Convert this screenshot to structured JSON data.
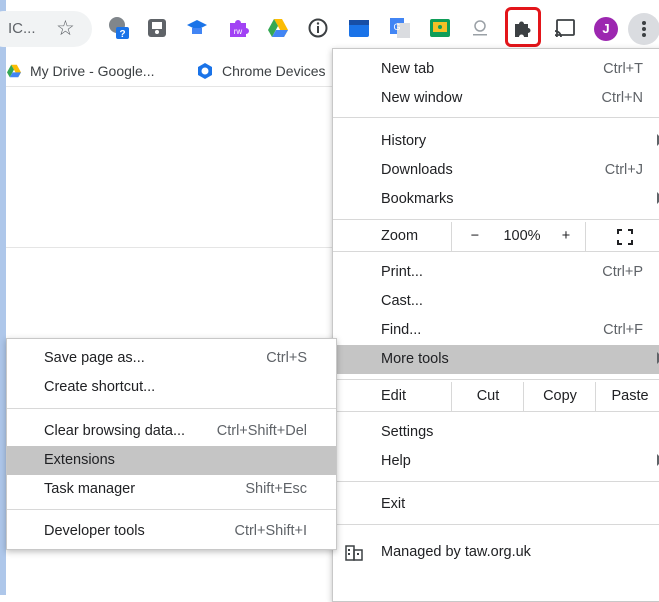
{
  "toolbar": {
    "omnibox_text": "IC...",
    "icons": [
      "star-icon",
      "extension-speech-icon",
      "extension-save-icon",
      "extension-graduation-icon",
      "extension-rw-icon",
      "google-drive-icon",
      "info-icon",
      "extension-calendar-icon",
      "google-translate-icon",
      "google-classroom-icon",
      "extension-search-icon",
      "puzzle-icon",
      "cast-icon",
      "avatar",
      "more-vert-icon"
    ],
    "avatar_letter": "J",
    "extension_badge": "?",
    "rw_badge": "rw",
    "colors": {
      "puzzle_highlight": "#e3151a",
      "avatar": "#9c27b0"
    }
  },
  "bookmarks": [
    {
      "label": "My Drive - Google...",
      "icon": "google-drive-icon"
    },
    {
      "label": "Chrome Devices",
      "icon": "chrome-devices-icon"
    }
  ],
  "menu": {
    "new_tab": {
      "label": "New tab",
      "shortcut": "Ctrl+T"
    },
    "new_window": {
      "label": "New window",
      "shortcut": "Ctrl+N"
    },
    "history": {
      "label": "History"
    },
    "downloads": {
      "label": "Downloads",
      "shortcut": "Ctrl+J"
    },
    "bookmarks": {
      "label": "Bookmarks"
    },
    "zoom": {
      "label": "Zoom",
      "minus": "−",
      "value": "100%",
      "plus": "+"
    },
    "print": {
      "label": "Print...",
      "shortcut": "Ctrl+P"
    },
    "cast": {
      "label": "Cast..."
    },
    "find": {
      "label": "Find...",
      "shortcut": "Ctrl+F"
    },
    "more_tools": {
      "label": "More tools"
    },
    "edit": {
      "label": "Edit",
      "cut": "Cut",
      "copy": "Copy",
      "paste": "Paste"
    },
    "settings": {
      "label": "Settings"
    },
    "help": {
      "label": "Help"
    },
    "exit": {
      "label": "Exit"
    },
    "managed": {
      "label": "Managed by taw.org.uk"
    }
  },
  "submenu": {
    "save_page": {
      "label": "Save page as...",
      "shortcut": "Ctrl+S"
    },
    "create_shortcut": {
      "label": "Create shortcut..."
    },
    "clear_data": {
      "label": "Clear browsing data...",
      "shortcut": "Ctrl+Shift+Del"
    },
    "extensions": {
      "label": "Extensions"
    },
    "task_manager": {
      "label": "Task manager",
      "shortcut": "Shift+Esc"
    },
    "dev_tools": {
      "label": "Developer tools",
      "shortcut": "Ctrl+Shift+I"
    }
  }
}
